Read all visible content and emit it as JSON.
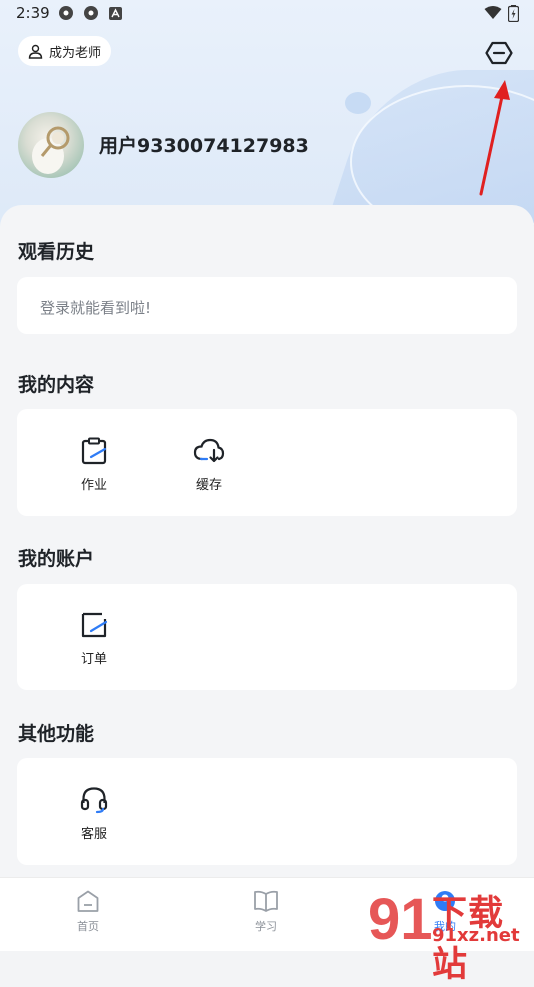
{
  "status_bar": {
    "time": "2:39"
  },
  "header": {
    "become_teacher_label": "成为老师",
    "username": "用户9330074127983"
  },
  "sections": {
    "history": {
      "title": "观看历史",
      "hint": "登录就能看到啦!"
    },
    "my_content": {
      "title": "我的内容",
      "items": [
        {
          "label": "作业",
          "icon": "clipboard-icon"
        },
        {
          "label": "缓存",
          "icon": "cloud-download-icon"
        }
      ]
    },
    "my_account": {
      "title": "我的账户",
      "items": [
        {
          "label": "订单",
          "icon": "order-icon"
        }
      ]
    },
    "other": {
      "title": "其他功能",
      "items": [
        {
          "label": "客服",
          "icon": "headset-icon"
        }
      ]
    }
  },
  "tabbar": {
    "items": [
      {
        "label": "首页",
        "icon": "home-icon"
      },
      {
        "label": "学习",
        "icon": "book-icon"
      },
      {
        "label": "我的",
        "icon": "profile-icon"
      }
    ]
  },
  "watermark": {
    "brand": "下载站",
    "domain": "91xz.net",
    "logo_text": "91"
  },
  "colors": {
    "accent": "#2f7cf6",
    "annotation_arrow": "#e02020",
    "watermark": "#e23a3a"
  }
}
